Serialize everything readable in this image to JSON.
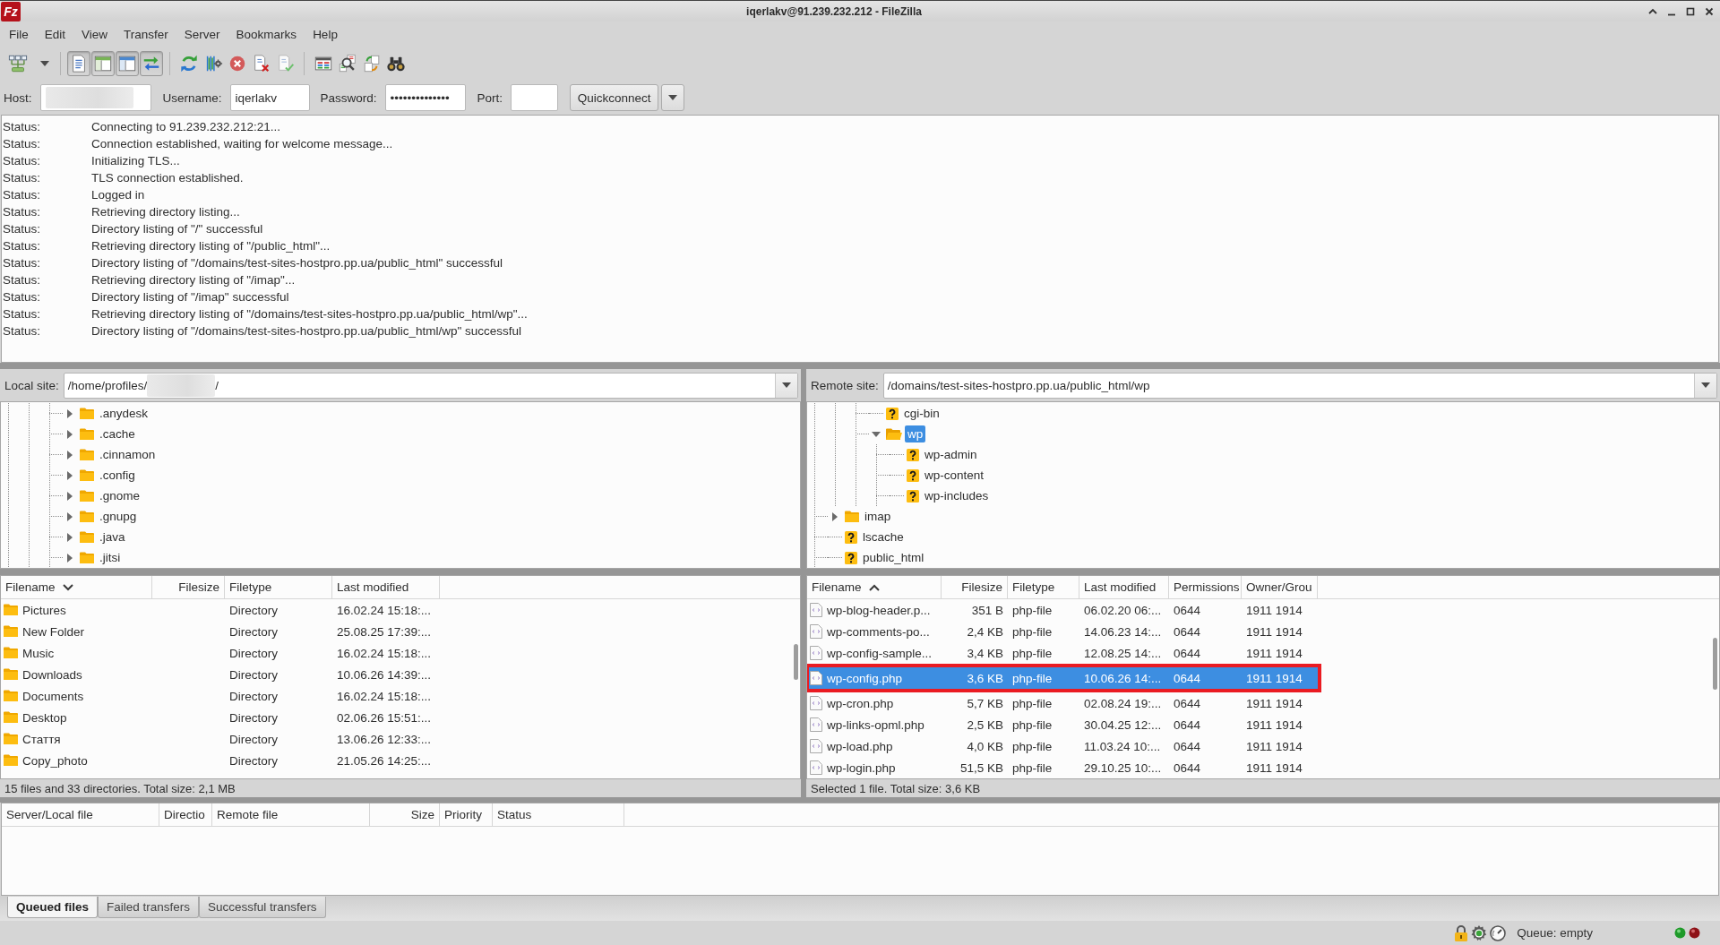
{
  "window": {
    "logo": "Fz",
    "title": "iqerlakv@91.239.232.212 - FileZilla"
  },
  "menu": [
    "File",
    "Edit",
    "View",
    "Transfer",
    "Server",
    "Bookmarks",
    "Help"
  ],
  "toolbar": {
    "view_toggles": [
      {
        "pressed": true
      },
      {
        "pressed": true
      },
      {
        "pressed": true
      },
      {
        "pressed": true
      }
    ]
  },
  "quickconnect": {
    "host": {
      "label": "Host:",
      "redacted": true
    },
    "username": {
      "label": "Username:",
      "value": "iqerlakv"
    },
    "password": {
      "label": "Password:",
      "value": "••••••••••••••"
    },
    "port": {
      "label": "Port:"
    },
    "button": "Quickconnect"
  },
  "message_log": [
    {
      "type": "Status:",
      "message": "Connecting to 91.239.232.212:21..."
    },
    {
      "type": "Status:",
      "message": "Connection established, waiting for welcome message..."
    },
    {
      "type": "Status:",
      "message": "Initializing TLS..."
    },
    {
      "type": "Status:",
      "message": "TLS connection established."
    },
    {
      "type": "Status:",
      "message": "Logged in"
    },
    {
      "type": "Status:",
      "message": "Retrieving directory listing..."
    },
    {
      "type": "Status:",
      "message": "Directory listing of \"/\" successful"
    },
    {
      "type": "Status:",
      "message": "Retrieving directory listing of \"/public_html\"..."
    },
    {
      "type": "Status:",
      "message": "Directory listing of \"/domains/test-sites-hostpro.pp.ua/public_html\" successful"
    },
    {
      "type": "Status:",
      "message": "Retrieving directory listing of \"/imap\"..."
    },
    {
      "type": "Status:",
      "message": "Directory listing of \"/imap\" successful"
    },
    {
      "type": "Status:",
      "message": "Retrieving directory listing of \"/domains/test-sites-hostpro.pp.ua/public_html/wp\"..."
    },
    {
      "type": "Status:",
      "message": "Directory listing of \"/domains/test-sites-hostpro.pp.ua/public_html/wp\" successful"
    }
  ],
  "local": {
    "site_label": "Local site:",
    "path": [
      "/home/profiles/",
      "/"
    ],
    "redacted": true,
    "tree": [
      {
        "children": [
          {
            "children": [
              {
                "children": [
                  {
                    "label": ".anydesk",
                    "kind": "folder",
                    "expanded": false,
                    "selected": false
                  },
                  {
                    "label": ".cache",
                    "kind": "folder",
                    "expanded": false,
                    "selected": false
                  },
                  {
                    "label": ".cinnamon",
                    "kind": "folder",
                    "expanded": false,
                    "selected": false
                  },
                  {
                    "label": ".config",
                    "kind": "folder",
                    "expanded": false,
                    "selected": false
                  },
                  {
                    "label": ".gnome",
                    "kind": "folder",
                    "expanded": false,
                    "selected": false
                  },
                  {
                    "label": ".gnupg",
                    "kind": "folder",
                    "expanded": false,
                    "selected": false
                  },
                  {
                    "label": ".java",
                    "kind": "folder",
                    "expanded": false,
                    "selected": false
                  },
                  {
                    "label": ".jitsi",
                    "kind": "folder",
                    "expanded": false,
                    "selected": false
                  }
                ]
              }
            ]
          }
        ]
      }
    ],
    "columns": [
      {
        "label": "Filename",
        "kind": "text",
        "sorted": true,
        "ascending": false
      },
      {
        "label": "Filesize",
        "kind": "number",
        "sorted": false
      },
      {
        "label": "Filetype",
        "kind": "text",
        "sorted": false
      },
      {
        "label": "Last modified",
        "kind": "text",
        "sorted": false
      }
    ],
    "rows": [
      {
        "kind": "folder",
        "name": "Pictures",
        "type": "Directory",
        "modified": "16.02.24 15:18:...",
        "selected": false
      },
      {
        "kind": "folder",
        "name": "New Folder",
        "type": "Directory",
        "modified": "25.08.25 17:39:...",
        "selected": false
      },
      {
        "kind": "folder",
        "name": "Music",
        "type": "Directory",
        "modified": "16.02.24 15:18:...",
        "selected": false
      },
      {
        "kind": "folder",
        "name": "Downloads",
        "type": "Directory",
        "modified": "10.06.26 14:39:...",
        "selected": false
      },
      {
        "kind": "folder",
        "name": "Documents",
        "type": "Directory",
        "modified": "16.02.24 15:18:...",
        "selected": false
      },
      {
        "kind": "folder",
        "name": "Desktop",
        "type": "Directory",
        "modified": "02.06.26 15:51:...",
        "selected": false
      },
      {
        "kind": "folder",
        "name": "Стаття",
        "type": "Directory",
        "modified": "13.06.26 12:33:...",
        "selected": false
      },
      {
        "kind": "folder",
        "name": "Copy_photo",
        "type": "Directory",
        "modified": "21.05.26 14:25:...",
        "selected": false
      }
    ],
    "status": "15 files and 33 directories. Total size: 2,1 MB"
  },
  "remote": {
    "site_label": "Remote site:",
    "path": [
      "/domains/test-sites-hostpro.pp.ua/public_html/wp"
    ],
    "tree": [
      {
        "children": [
          {
            "children": [
              {
                "children": [
                  {
                    "label": "cgi-bin",
                    "kind": "unknown",
                    "selected": false
                  },
                  {
                    "label": "wp",
                    "kind": "folder",
                    "expanded": true,
                    "selected": true,
                    "children": [
                      {
                        "label": "wp-admin",
                        "kind": "unknown",
                        "selected": false
                      },
                      {
                        "label": "wp-content",
                        "kind": "unknown",
                        "selected": false
                      },
                      {
                        "label": "wp-includes",
                        "kind": "unknown",
                        "selected": false
                      }
                    ]
                  }
                ]
              }
            ]
          },
          {
            "label": "imap",
            "kind": "folder",
            "expanded": false,
            "selected": false
          },
          {
            "label": "lscache",
            "kind": "unknown",
            "selected": false
          },
          {
            "label": "public_html",
            "kind": "unknown",
            "selected": false
          }
        ]
      }
    ],
    "columns": [
      {
        "label": "Filename",
        "kind": "text",
        "sorted": true,
        "ascending": true
      },
      {
        "label": "Filesize",
        "kind": "number",
        "sorted": false
      },
      {
        "label": "Filetype",
        "kind": "text",
        "sorted": false
      },
      {
        "label": "Last modified",
        "kind": "text",
        "sorted": false
      },
      {
        "label": "Permissions",
        "kind": "text",
        "sorted": false
      },
      {
        "label": "Owner/Grou",
        "kind": "text",
        "sorted": false
      }
    ],
    "rows": [
      {
        "kind": "file",
        "name": "wp-blog-header.p...",
        "size": "351 B",
        "type": "php-file",
        "modified": "06.02.20 06:...",
        "permissions": "0644",
        "owner": "1911 1914",
        "selected": false,
        "highlighted": false
      },
      {
        "kind": "file",
        "name": "wp-comments-po...",
        "size": "2,4 KB",
        "type": "php-file",
        "modified": "14.06.23 14:...",
        "permissions": "0644",
        "owner": "1911 1914",
        "selected": false,
        "highlighted": false
      },
      {
        "kind": "file",
        "name": "wp-config-sample...",
        "size": "3,4 KB",
        "type": "php-file",
        "modified": "12.08.25 14:...",
        "permissions": "0644",
        "owner": "1911 1914",
        "selected": false,
        "highlighted": false
      },
      {
        "kind": "file",
        "name": "wp-config.php",
        "size": "3,6 KB",
        "type": "php-file",
        "modified": "10.06.26 14:...",
        "permissions": "0644",
        "owner": "1911 1914",
        "selected": true,
        "highlighted": true
      },
      {
        "kind": "file",
        "name": "wp-cron.php",
        "size": "5,7 KB",
        "type": "php-file",
        "modified": "02.08.24 19:...",
        "permissions": "0644",
        "owner": "1911 1914",
        "selected": false,
        "highlighted": false
      },
      {
        "kind": "file",
        "name": "wp-links-opml.php",
        "size": "2,5 KB",
        "type": "php-file",
        "modified": "30.04.25 12:...",
        "permissions": "0644",
        "owner": "1911 1914",
        "selected": false,
        "highlighted": false
      },
      {
        "kind": "file",
        "name": "wp-load.php",
        "size": "4,0 KB",
        "type": "php-file",
        "modified": "11.03.24 10:...",
        "permissions": "0644",
        "owner": "1911 1914",
        "selected": false,
        "highlighted": false
      },
      {
        "kind": "file",
        "name": "wp-login.php",
        "size": "51,5 KB",
        "type": "php-file",
        "modified": "29.10.25 10:...",
        "permissions": "0644",
        "owner": "1911 1914",
        "selected": false,
        "highlighted": false
      }
    ],
    "status": "Selected 1 file. Total size: 3,6 KB"
  },
  "queue": {
    "columns": [
      {
        "label": "Server/Local file",
        "kind": "text"
      },
      {
        "label": "Directio",
        "kind": "text"
      },
      {
        "label": "Remote file",
        "kind": "text"
      },
      {
        "label": "Size",
        "kind": "number"
      },
      {
        "label": "Priority",
        "kind": "text"
      },
      {
        "label": "Status",
        "kind": "text"
      }
    ],
    "tabs": [
      {
        "label": "Queued files",
        "selected": true
      },
      {
        "label": "Failed transfers",
        "selected": false
      },
      {
        "label": "Successful transfers",
        "selected": false
      }
    ]
  },
  "status_bar": {
    "queue": "Queue: empty"
  }
}
